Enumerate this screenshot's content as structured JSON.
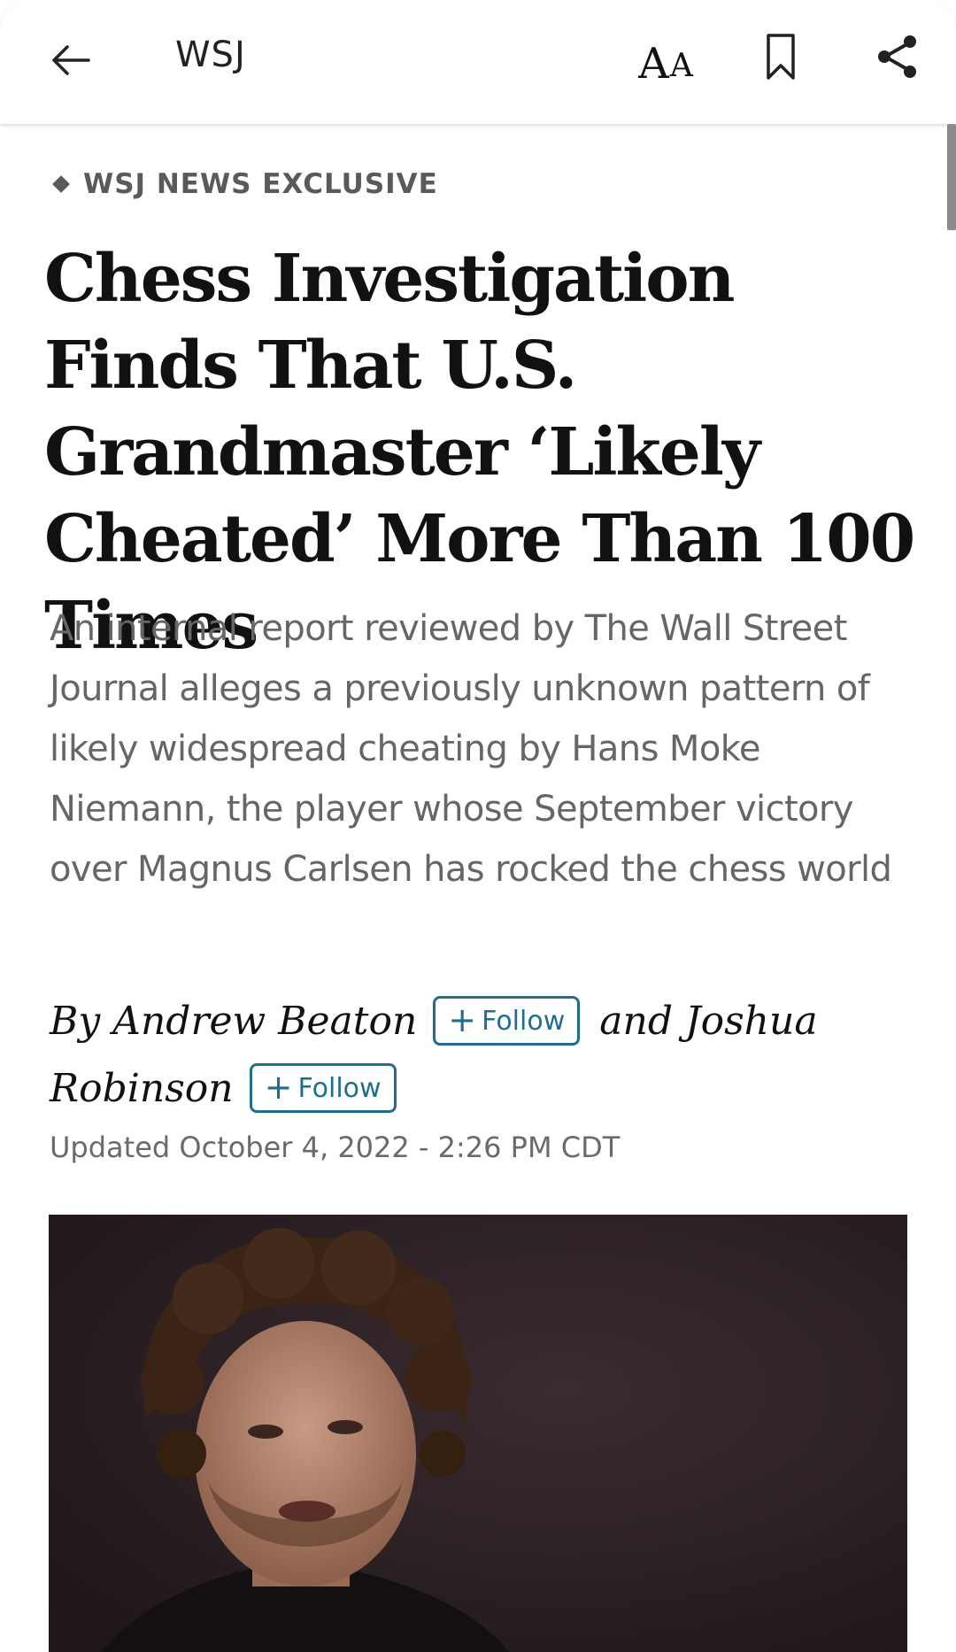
{
  "topbar": {
    "title": "WSJ",
    "font_size_label_big": "A",
    "font_size_label_small": "A"
  },
  "article": {
    "kicker": "WSJ NEWS EXCLUSIVE",
    "headline": "Chess Investigation Finds That U.S. Grandmaster ‘Likely Cheated’ More Than 100 Times",
    "dek": "An internal report reviewed by The Wall Street Journal alleges a previously unknown pattern of likely widespread cheating by Hans Moke Niemann, the player whose September victory over Magnus Carlsen has rocked the chess world",
    "byline": {
      "prefix": "By Andrew Beaton",
      "joiner": "and Joshua",
      "second_line": "Robinson",
      "follow_label": "Follow",
      "follow_symbol": "+"
    },
    "timestamp": "Updated October 4, 2022 - 2:26 PM CDT"
  },
  "colors": {
    "follow_accent": "#1f6e8c",
    "kicker": "#5a5a5a",
    "dek": "#666666",
    "headline": "#111111"
  },
  "icons": [
    "back-arrow-icon",
    "font-size-icon",
    "bookmark-icon",
    "share-icon"
  ]
}
